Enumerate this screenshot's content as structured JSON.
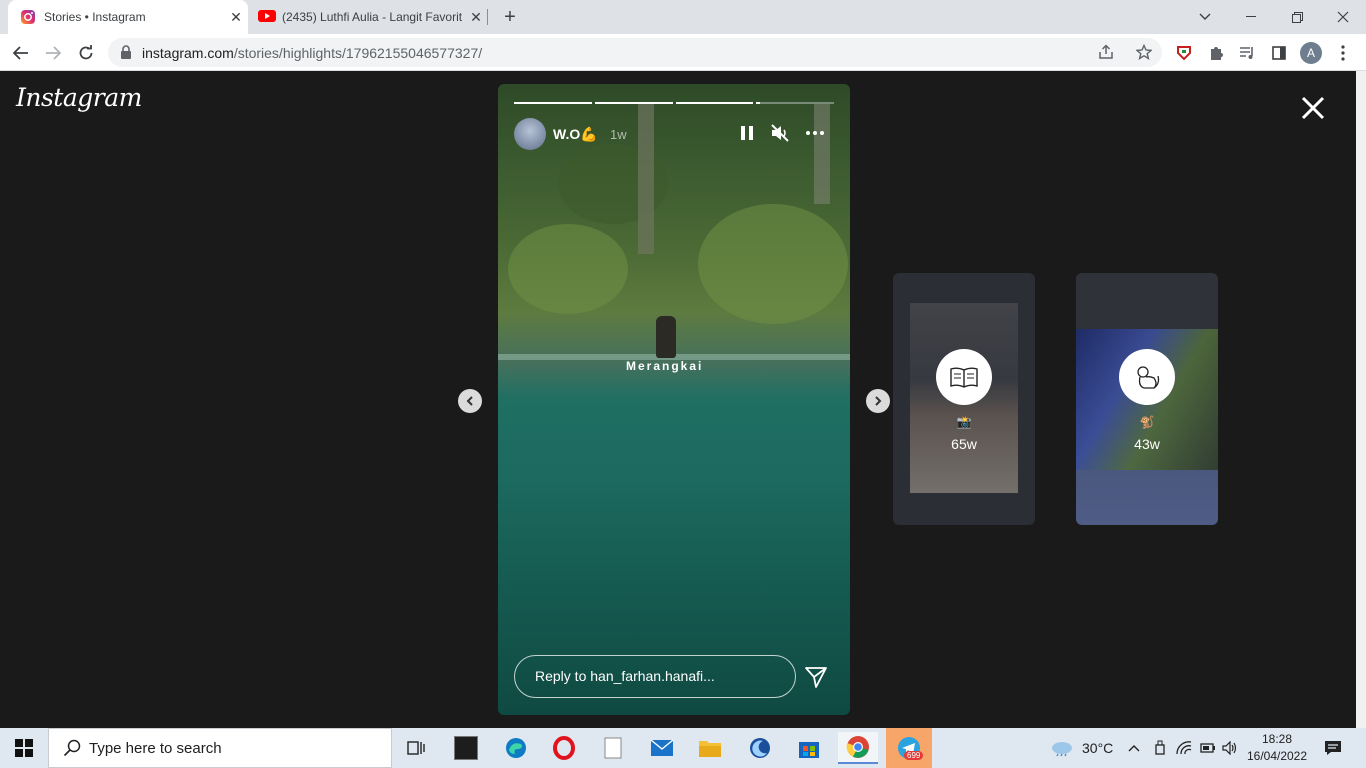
{
  "browser": {
    "tabs": [
      {
        "title": "Stories • Instagram",
        "close": "✕"
      },
      {
        "title": "(2435) Luthfi Aulia - Langit Favorit",
        "close": "✕"
      }
    ],
    "new_tab": "+",
    "url_host": "instagram.com",
    "url_path": "/stories/highlights/17962155046577327/",
    "profile_initial": "A"
  },
  "page": {
    "logo": "Instagram",
    "story": {
      "username": "W.O💪",
      "time": "1w",
      "caption": "Merangkai",
      "reply_placeholder": "Reply to han_farhan.hanafi...",
      "progress": [
        1,
        1,
        1,
        0.05
      ]
    },
    "previews": [
      {
        "emoji": "📸",
        "age": "65w",
        "icon": "book-icon"
      },
      {
        "emoji": "🐒",
        "age": "43w",
        "icon": "monkey-icon"
      }
    ]
  },
  "taskbar": {
    "search_placeholder": "Type here to search",
    "temperature": "30°C",
    "time": "18:28",
    "date": "16/04/2022",
    "telegram_badge": "699"
  },
  "colors": {
    "accent_youtube": "#ff0000",
    "page_bg": "#1a1a1a"
  }
}
